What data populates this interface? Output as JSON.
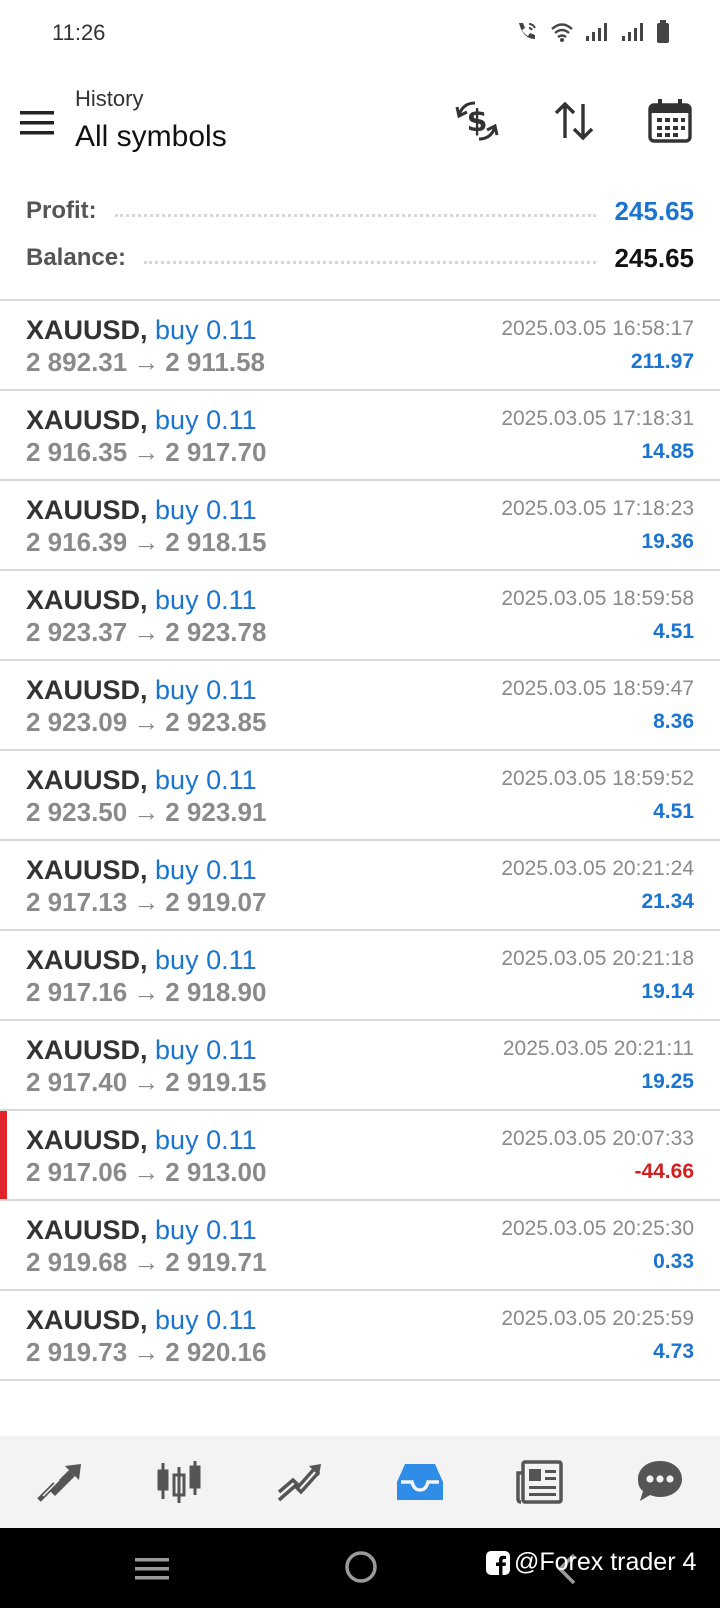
{
  "status_bar": {
    "time": "11:26"
  },
  "header": {
    "subtitle": "History",
    "title": "All symbols"
  },
  "summary": {
    "profit_label": "Profit:",
    "profit_value": "245.65",
    "balance_label": "Balance:",
    "balance_value": "245.65"
  },
  "deals": [
    {
      "symbol": "XAUUSD,",
      "side": "buy 0.11",
      "open": "2 892.31",
      "close": "2 911.58",
      "time": "2025.03.05 16:58:17",
      "profit": "211.97",
      "loss": false
    },
    {
      "symbol": "XAUUSD,",
      "side": "buy 0.11",
      "open": "2 916.35",
      "close": "2 917.70",
      "time": "2025.03.05 17:18:31",
      "profit": "14.85",
      "loss": false
    },
    {
      "symbol": "XAUUSD,",
      "side": "buy 0.11",
      "open": "2 916.39",
      "close": "2 918.15",
      "time": "2025.03.05 17:18:23",
      "profit": "19.36",
      "loss": false
    },
    {
      "symbol": "XAUUSD,",
      "side": "buy 0.11",
      "open": "2 923.37",
      "close": "2 923.78",
      "time": "2025.03.05 18:59:58",
      "profit": "4.51",
      "loss": false
    },
    {
      "symbol": "XAUUSD,",
      "side": "buy 0.11",
      "open": "2 923.09",
      "close": "2 923.85",
      "time": "2025.03.05 18:59:47",
      "profit": "8.36",
      "loss": false
    },
    {
      "symbol": "XAUUSD,",
      "side": "buy 0.11",
      "open": "2 923.50",
      "close": "2 923.91",
      "time": "2025.03.05 18:59:52",
      "profit": "4.51",
      "loss": false
    },
    {
      "symbol": "XAUUSD,",
      "side": "buy 0.11",
      "open": "2 917.13",
      "close": "2 919.07",
      "time": "2025.03.05 20:21:24",
      "profit": "21.34",
      "loss": false
    },
    {
      "symbol": "XAUUSD,",
      "side": "buy 0.11",
      "open": "2 917.16",
      "close": "2 918.90",
      "time": "2025.03.05 20:21:18",
      "profit": "19.14",
      "loss": false
    },
    {
      "symbol": "XAUUSD,",
      "side": "buy 0.11",
      "open": "2 917.40",
      "close": "2 919.15",
      "time": "2025.03.05 20:21:11",
      "profit": "19.25",
      "loss": false
    },
    {
      "symbol": "XAUUSD,",
      "side": "buy 0.11",
      "open": "2 917.06",
      "close": "2 913.00",
      "time": "2025.03.05 20:07:33",
      "profit": "-44.66",
      "loss": true
    },
    {
      "symbol": "XAUUSD,",
      "side": "buy 0.11",
      "open": "2 919.68",
      "close": "2 919.71",
      "time": "2025.03.05 20:25:30",
      "profit": "0.33",
      "loss": false
    },
    {
      "symbol": "XAUUSD,",
      "side": "buy 0.11",
      "open": "2 919.73",
      "close": "2 920.16",
      "time": "2025.03.05 20:25:59",
      "profit": "4.73",
      "loss": false
    }
  ],
  "bottom_nav": [
    {
      "icon": "quotes-icon",
      "active": false
    },
    {
      "icon": "chart-candles-icon",
      "active": false
    },
    {
      "icon": "trade-icon",
      "active": false
    },
    {
      "icon": "history-inbox-icon",
      "active": true
    },
    {
      "icon": "news-icon",
      "active": false
    },
    {
      "icon": "chat-icon",
      "active": false
    }
  ],
  "watermark": {
    "text": "@Forex trader 4"
  },
  "colors": {
    "accent_blue": "#1b75d0",
    "loss_red": "#d02020",
    "loss_marker": "#e0242a",
    "muted_gray": "#8a8a8a",
    "nav_active": "#2f8de8",
    "nav_inactive": "#555555"
  }
}
